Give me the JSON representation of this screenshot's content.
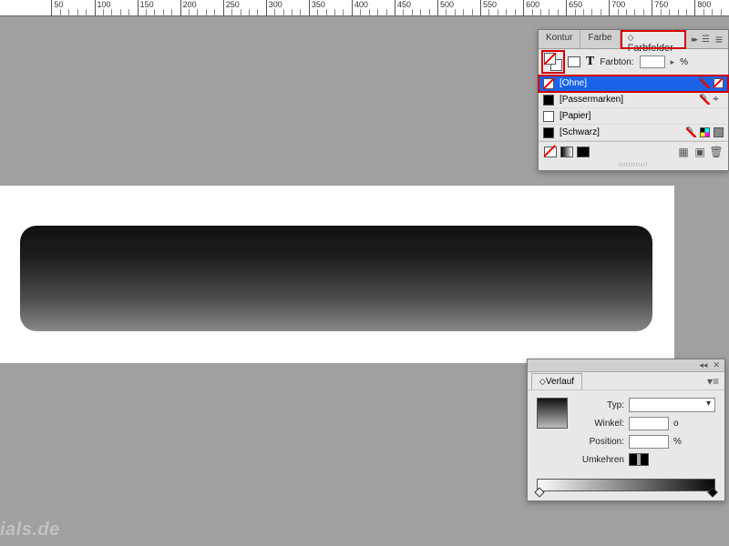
{
  "ruler": {
    "majors": [
      50,
      100,
      150,
      200,
      250,
      300,
      350,
      400,
      450,
      500,
      550,
      600,
      650,
      700,
      750,
      800
    ]
  },
  "swatches_panel": {
    "tabs": {
      "t1": "Kontur",
      "t2": "Farbe",
      "t3": "Farbfelder"
    },
    "tint_label": "Farbton:",
    "tint_value": "",
    "tint_unit": "%",
    "rows": [
      {
        "name": "[Ohne]"
      },
      {
        "name": "[Passermarken]"
      },
      {
        "name": "[Papier]"
      },
      {
        "name": "[Schwarz]"
      }
    ]
  },
  "gradient_panel": {
    "title": "Verlauf",
    "type_label": "Typ:",
    "type_value": "",
    "angle_label": "Winkel:",
    "angle_value": "",
    "angle_unit": "o",
    "position_label": "Position:",
    "position_value": "",
    "position_unit": "%",
    "reverse_label": "Umkehren"
  },
  "watermark": "ials.de"
}
